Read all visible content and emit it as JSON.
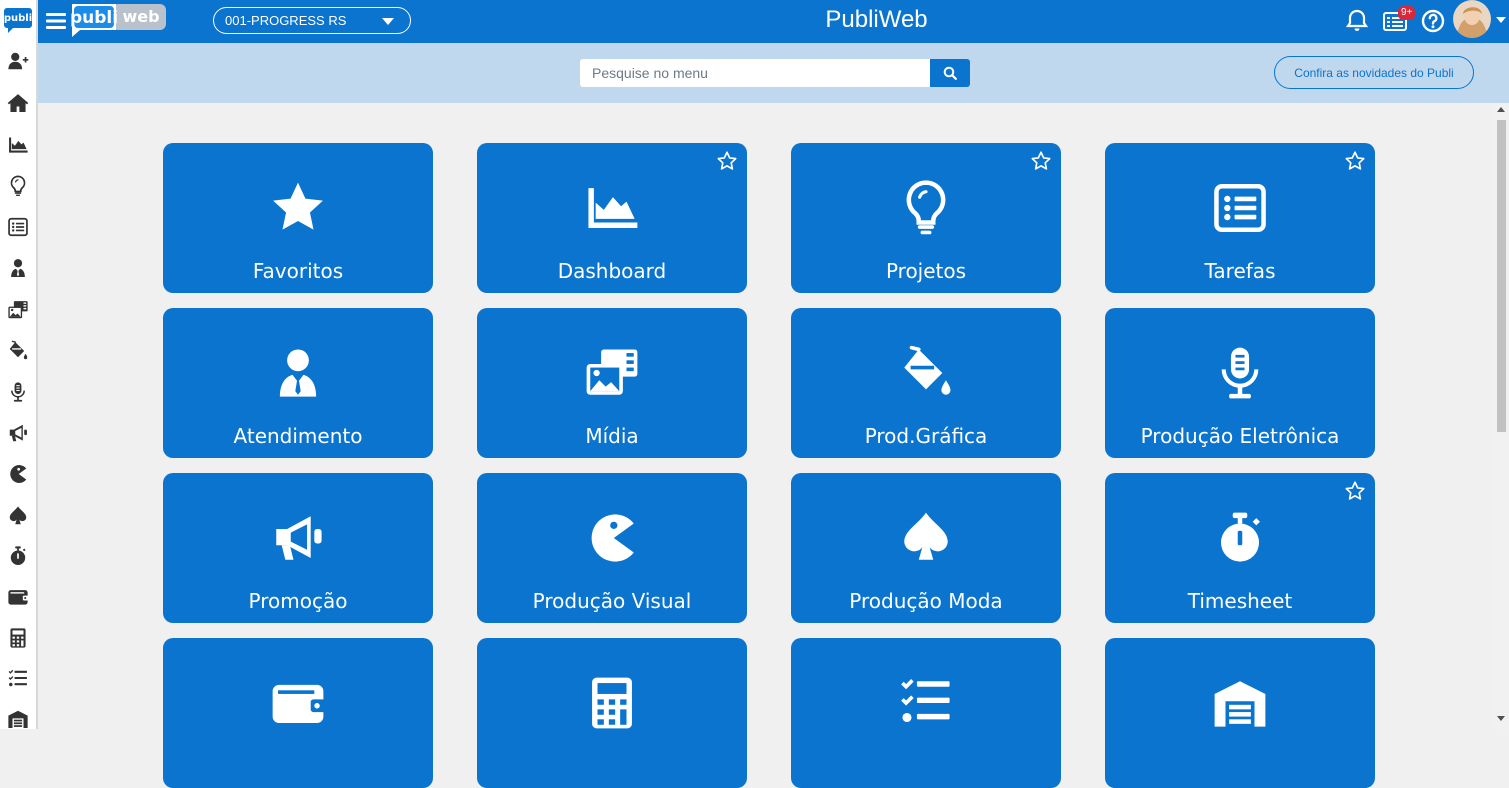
{
  "header": {
    "app_title": "PubliWeb",
    "logo_left": "publi",
    "logo_right": "web",
    "rail_logo": "publi",
    "company": "001-PROGRESS RS",
    "notification_badge": "9+"
  },
  "search": {
    "placeholder": "Pesquise no menu"
  },
  "news_button": "Confira as novidades do Publi",
  "tiles": [
    {
      "label": "Favoritos",
      "icon": "star-icon",
      "favorite_toggle": false
    },
    {
      "label": "Dashboard",
      "icon": "area-chart-icon",
      "favorite_toggle": true
    },
    {
      "label": "Projetos",
      "icon": "lightbulb-icon",
      "favorite_toggle": true
    },
    {
      "label": "Tarefas",
      "icon": "list-alt-icon",
      "favorite_toggle": true
    },
    {
      "label": "Atendimento",
      "icon": "user-tie-icon",
      "favorite_toggle": false
    },
    {
      "label": "Mídia",
      "icon": "photo-video-icon",
      "favorite_toggle": false
    },
    {
      "label": "Prod.Gráfica",
      "icon": "fill-drip-icon",
      "favorite_toggle": false
    },
    {
      "label": "Produção Eletrônica",
      "icon": "microphone-icon",
      "favorite_toggle": false
    },
    {
      "label": "Promoção",
      "icon": "bullhorn-icon",
      "favorite_toggle": false
    },
    {
      "label": "Produção Visual",
      "icon": "pacman-icon",
      "favorite_toggle": false
    },
    {
      "label": "Produção Moda",
      "icon": "spade-icon",
      "favorite_toggle": false
    },
    {
      "label": "Timesheet",
      "icon": "stopwatch-icon",
      "favorite_toggle": true
    },
    {
      "label": "",
      "icon": "wallet-icon",
      "favorite_toggle": false
    },
    {
      "label": "",
      "icon": "calculator-icon",
      "favorite_toggle": false
    },
    {
      "label": "",
      "icon": "tasks-icon",
      "favorite_toggle": false
    },
    {
      "label": "",
      "icon": "warehouse-icon",
      "favorite_toggle": false
    }
  ],
  "sidebar": {
    "items": [
      "add-user-icon",
      "home-icon",
      "area-chart-icon",
      "lightbulb-icon",
      "list-alt-icon",
      "user-tie-icon",
      "photo-video-icon",
      "fill-drip-icon",
      "microphone-icon",
      "bullhorn-icon",
      "pacman-icon",
      "spade-icon",
      "stopwatch-icon",
      "wallet-icon",
      "calculator-icon",
      "tasks-icon",
      "warehouse-icon"
    ]
  },
  "colors": {
    "primary": "#0a74cf",
    "band": "#c0d8ee",
    "background": "#f0f0f0",
    "badge": "#d9283a",
    "rail_icon": "#333333"
  }
}
